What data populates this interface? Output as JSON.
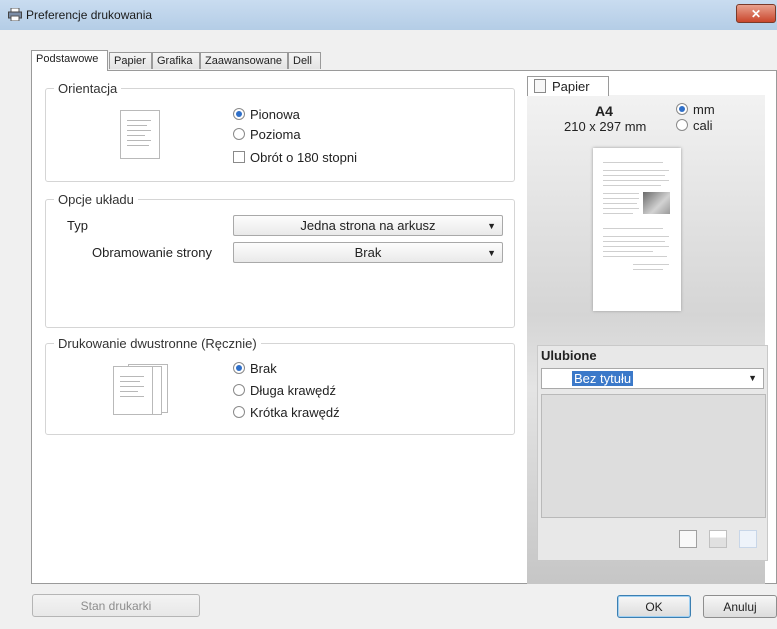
{
  "window": {
    "title": "Preferencje drukowania",
    "close_label": "✕"
  },
  "tabs": [
    {
      "label": "Podstawowe",
      "active": true
    },
    {
      "label": "Papier",
      "active": false
    },
    {
      "label": "Grafika",
      "active": false
    },
    {
      "label": "Zaawansowane",
      "active": false
    },
    {
      "label": "Dell",
      "active": false
    }
  ],
  "orientation": {
    "legend": "Orientacja",
    "options": [
      "Pionowa",
      "Pozioma"
    ],
    "selected": "Pionowa",
    "rotate_label": "Obrót o 180 stopni",
    "rotate_checked": false
  },
  "layout": {
    "legend": "Opcje układu",
    "type_label": "Typ",
    "type_value": "Jedna strona na arkusz",
    "border_label": "Obramowanie strony",
    "border_value": "Brak"
  },
  "duplex": {
    "legend": "Drukowanie dwustronne (Ręcznie)",
    "options": [
      "Brak",
      "Długa krawędź",
      "Krótka krawędź"
    ],
    "selected": "Brak"
  },
  "preview": {
    "tab_label": "Papier",
    "paper_name": "A4",
    "paper_size": "210 x 297 mm",
    "units": [
      "mm",
      "cali"
    ],
    "unit_selected": "mm"
  },
  "favorites": {
    "title": "Ulubione",
    "selected": "Bez tytułu"
  },
  "buttons": {
    "printer_status": "Stan drukarki",
    "ok": "OK",
    "cancel": "Anuluj"
  },
  "colors": {
    "titlebar": "#b4cde6",
    "close": "#c9462c",
    "radio_selected": "#2f6fc8",
    "selection": "#3b79c9"
  }
}
